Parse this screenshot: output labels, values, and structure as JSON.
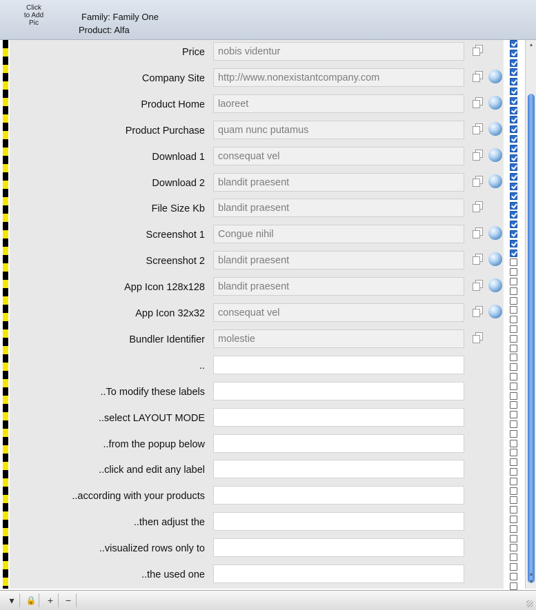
{
  "header": {
    "pic_lines": [
      "Click",
      "to Add",
      "Pic"
    ],
    "family_key": "Family:",
    "family_value": "Family One",
    "product_key": "Product:",
    "product_value": "Alfa"
  },
  "rows": [
    {
      "label": "Price",
      "value": "nobis videntur",
      "globe": false
    },
    {
      "label": "Company Site",
      "value": "http://www.nonexistantcompany.com",
      "globe": true
    },
    {
      "label": "Product Home",
      "value": "laoreet",
      "globe": true
    },
    {
      "label": "Product Purchase",
      "value": "quam nunc putamus",
      "globe": true
    },
    {
      "label": "Download 1",
      "value": "consequat vel",
      "globe": true
    },
    {
      "label": "Download 2",
      "value": "blandit praesent",
      "globe": true
    },
    {
      "label": "File Size Kb",
      "value": "blandit praesent",
      "globe": false
    },
    {
      "label": "Screenshot 1",
      "value": "Congue nihil",
      "globe": true
    },
    {
      "label": "Screenshot 2",
      "value": "blandit praesent",
      "globe": true
    },
    {
      "label": "App Icon 128x128",
      "value": "blandit praesent",
      "globe": true
    },
    {
      "label": "App Icon 32x32",
      "value": "consequat vel",
      "globe": true
    },
    {
      "label": "Bundler Identifier",
      "value": "molestie",
      "globe": false
    },
    {
      "label": "..",
      "value": "",
      "globe": false
    },
    {
      "label": "..To modify these labels",
      "value": "",
      "globe": false
    },
    {
      "label": "..select LAYOUT MODE",
      "value": "",
      "globe": false
    },
    {
      "label": "..from the popup below",
      "value": "",
      "globe": false
    },
    {
      "label": "..click and edit any label",
      "value": "",
      "globe": false
    },
    {
      "label": "..according with your products",
      "value": "",
      "globe": false
    },
    {
      "label": "..then adjust the",
      "value": "",
      "globe": false
    },
    {
      "label": "..visualized rows only to",
      "value": "",
      "globe": false
    },
    {
      "label": "..the used one",
      "value": "",
      "globe": false
    }
  ],
  "checkboxes": [
    true,
    true,
    true,
    true,
    true,
    true,
    true,
    true,
    true,
    true,
    true,
    true,
    true,
    true,
    true,
    true,
    true,
    true,
    true,
    true,
    true,
    true,
    true,
    false,
    false,
    false,
    false,
    false,
    false,
    false,
    false,
    false,
    false,
    false,
    false,
    false,
    false,
    false,
    false,
    false,
    false,
    false,
    false,
    false,
    false,
    false,
    false,
    false,
    false,
    false,
    false,
    false,
    false,
    false,
    false,
    false,
    false,
    false
  ],
  "bottom_bar": {
    "menu_glyph": "▾",
    "lock_glyph": "🔒",
    "add_glyph": "+",
    "remove_glyph": "−"
  },
  "icons": {
    "copy": "copy-icon",
    "globe": "globe-icon"
  },
  "colors": {
    "stripe_yellow": "#f5e600",
    "checkbox_on": "#2b6fcf",
    "scroll_thumb": "#3d7fd8"
  }
}
